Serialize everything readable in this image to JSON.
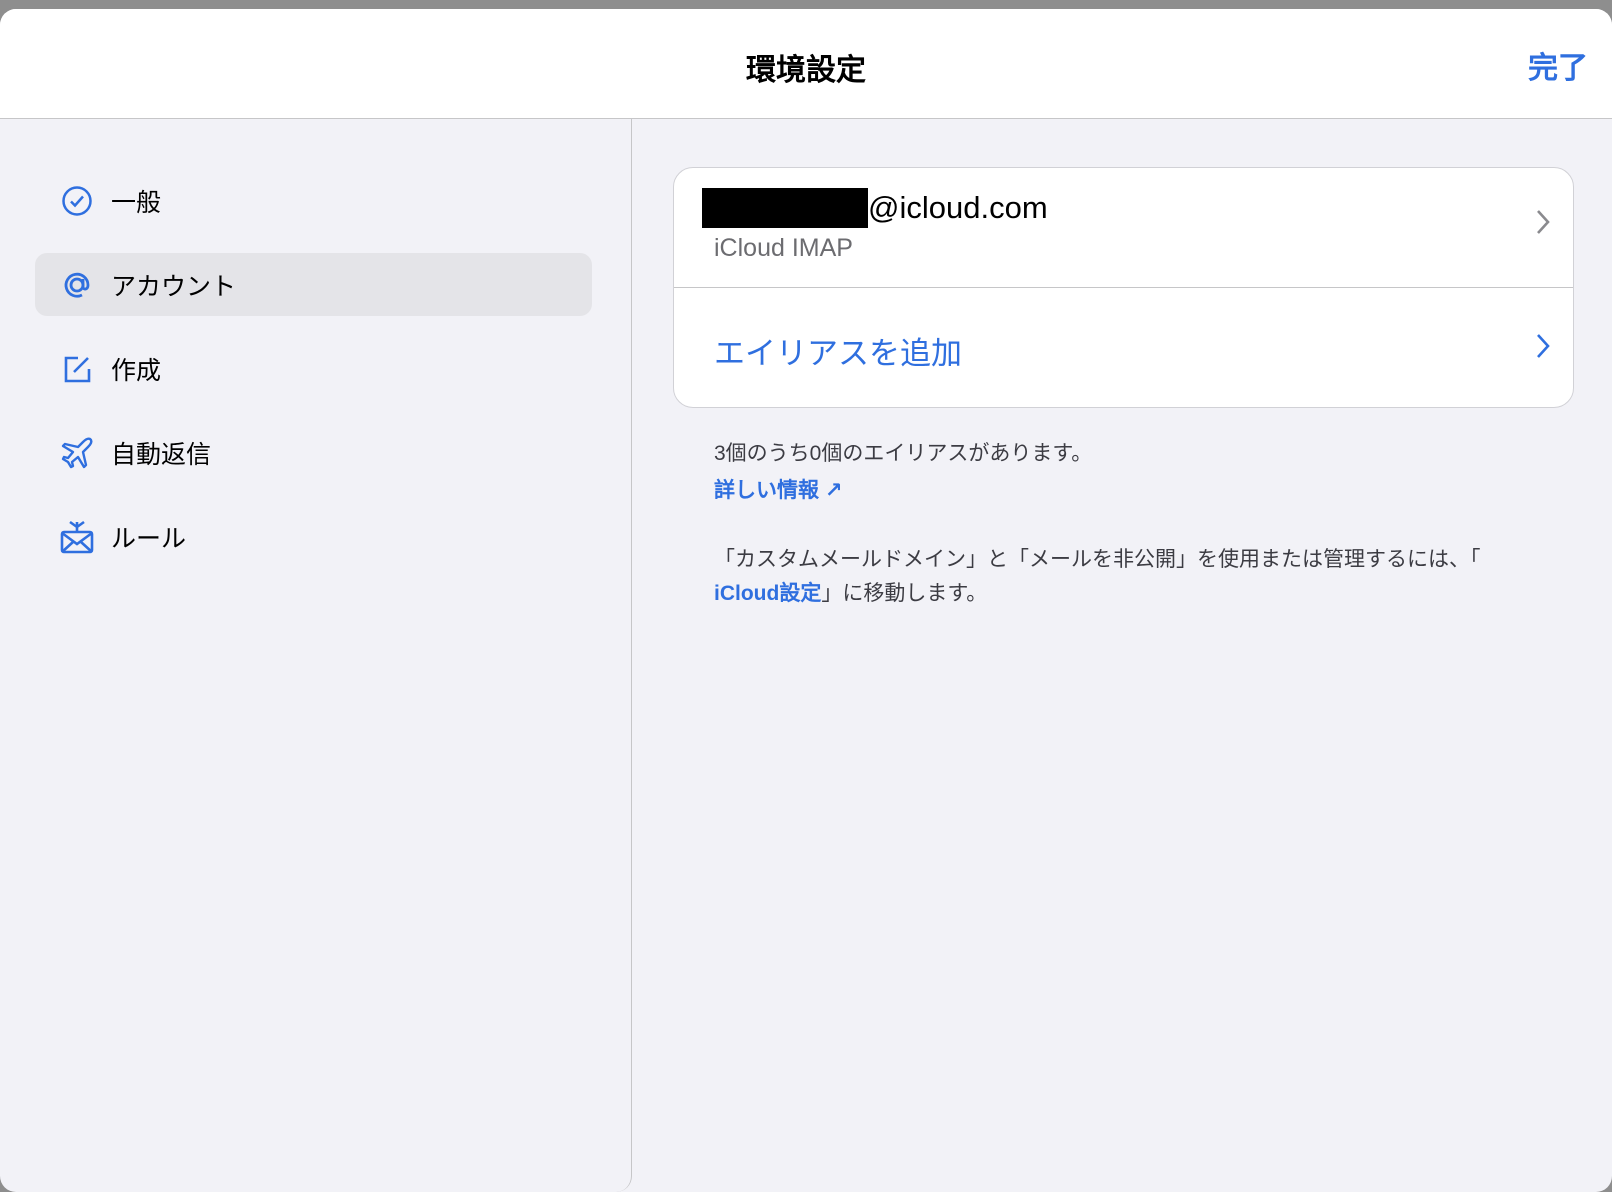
{
  "colors": {
    "accent": "#2f6fdf"
  },
  "header": {
    "title": "環境設定",
    "done_label": "完了"
  },
  "sidebar": {
    "items": [
      {
        "label": "一般",
        "icon": "checkmark-circle-icon"
      },
      {
        "label": "アカウント",
        "icon": "at-sign-icon",
        "selected": true
      },
      {
        "label": "作成",
        "icon": "compose-icon"
      },
      {
        "label": "自動返信",
        "icon": "airplane-icon"
      },
      {
        "label": "ルール",
        "icon": "envelope-rules-icon"
      }
    ]
  },
  "account": {
    "email_suffix": "@icloud.com",
    "type": "iCloud IMAP",
    "add_alias": "エイリアスを追加"
  },
  "notes": {
    "alias_count": "3個のうち0個のエイリアスがあります。",
    "learn_more": "詳しい情報",
    "learn_more_icon": "↗",
    "custom_domain": "「カスタムメールドメイン」と「メールを非公開」を使用または管理するには、「",
    "icloud_settings": "iCloud設定",
    "custom_domain_end": "」に移動します。"
  }
}
